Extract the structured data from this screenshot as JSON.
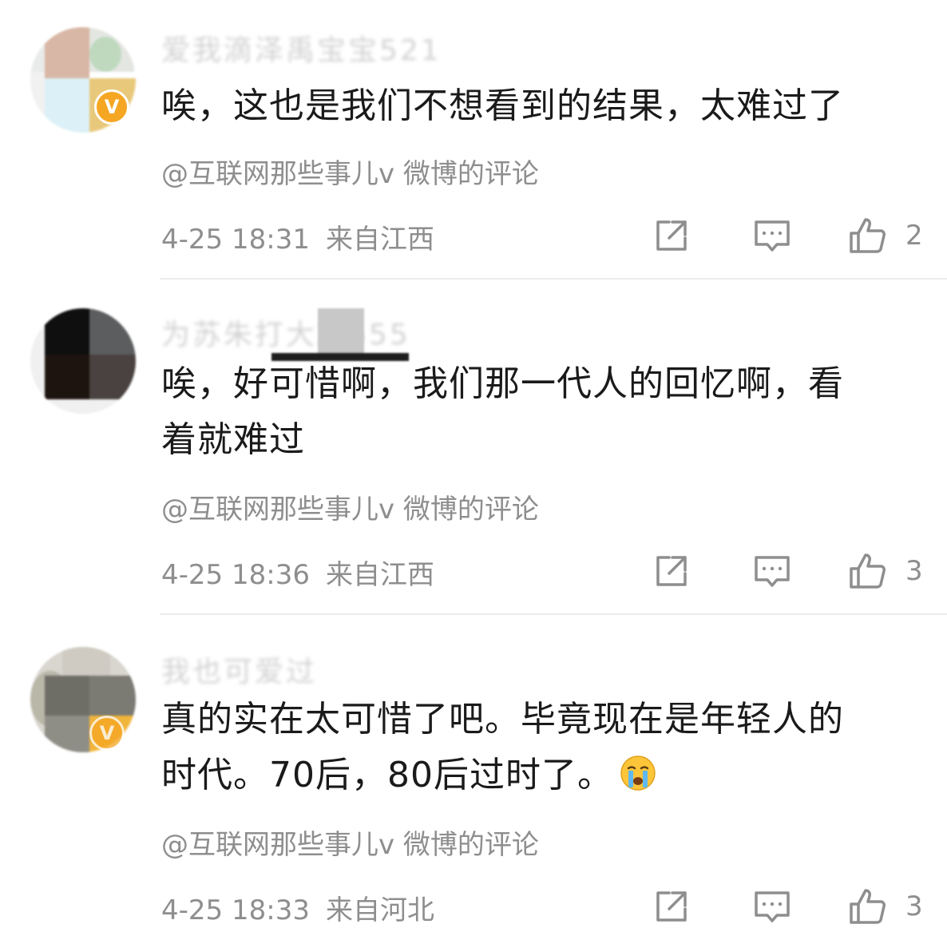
{
  "comments": [
    {
      "username": "爱我滴泽禹宝宝521",
      "text_lines": [
        "唉，这也是我们不想看到的结果，太难过了"
      ],
      "source": "@互联网那些事儿v 微博的评论",
      "time": "4-25 18:31",
      "location": "来自江西",
      "likes": "2",
      "verified": "V"
    },
    {
      "username": "为苏朱打大旗555",
      "text_lines": [
        "唉，好可惜啊，我们那一代人的回忆啊，看",
        "着就难过"
      ],
      "source": "@互联网那些事儿v 微博的评论",
      "time": "4-25 18:36",
      "location": "来自江西",
      "likes": "3"
    },
    {
      "username": "我也可爱过",
      "text_lines": [
        "真的实在太可惜了吧。毕竟现在是年轻人的",
        "时代。70后，80后过时了。"
      ],
      "source": "@互联网那些事儿v 微博的评论",
      "time": "4-25 18:33",
      "location": "来自河北",
      "likes": "3",
      "verified": "V"
    }
  ],
  "colors": {
    "text": "#1a1a1a",
    "meta": "#8e8e8e",
    "username": "#d2d2d2",
    "divider": "#ececec",
    "badge": "#f5a623"
  }
}
